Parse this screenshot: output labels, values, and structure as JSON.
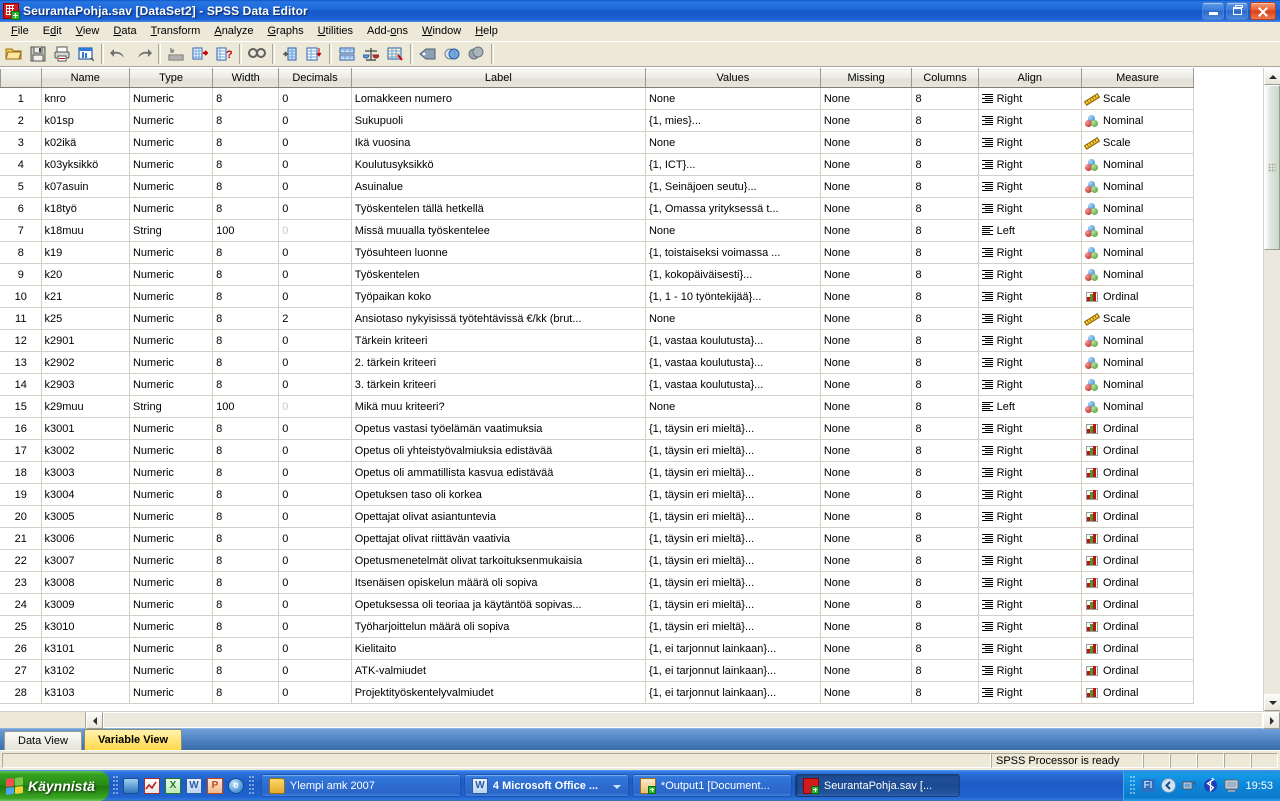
{
  "window": {
    "title": "SeurantaPohja.sav [DataSet2] - SPSS Data Editor",
    "icon": "spss-data-icon",
    "buttons": {
      "minimize": "Minimize",
      "restore": "Restore",
      "close": "Close"
    }
  },
  "menubar": [
    {
      "label": "File",
      "mnemonic": "F"
    },
    {
      "label": "Edit",
      "mnemonic": "E"
    },
    {
      "label": "View",
      "mnemonic": "V"
    },
    {
      "label": "Data",
      "mnemonic": "D"
    },
    {
      "label": "Transform",
      "mnemonic": "T"
    },
    {
      "label": "Analyze",
      "mnemonic": "A"
    },
    {
      "label": "Graphs",
      "mnemonic": "G"
    },
    {
      "label": "Utilities",
      "mnemonic": "U"
    },
    {
      "label": "Add-ons",
      "mnemonic": "o"
    },
    {
      "label": "Window",
      "mnemonic": "W"
    },
    {
      "label": "Help",
      "mnemonic": "H"
    }
  ],
  "toolbar": [
    {
      "name": "open-file",
      "glyph": "📂"
    },
    {
      "name": "save-file",
      "glyph": "💾"
    },
    {
      "name": "print",
      "glyph": "🖨"
    },
    {
      "name": "recall-dialogs",
      "glyph": "▤"
    },
    {
      "name": "undo",
      "glyph": "↶"
    },
    {
      "name": "redo",
      "glyph": "↷"
    },
    {
      "name": "goto-case",
      "glyph": "⬇"
    },
    {
      "name": "goto-variable",
      "glyph": "▦"
    },
    {
      "name": "variables",
      "glyph": "❓"
    },
    {
      "name": "find",
      "glyph": "🔍"
    },
    {
      "name": "insert-case",
      "glyph": "→"
    },
    {
      "name": "insert-variable",
      "glyph": "⬇"
    },
    {
      "name": "split-file",
      "glyph": "☷"
    },
    {
      "name": "weight-cases",
      "glyph": "⚖"
    },
    {
      "name": "select-cases",
      "glyph": "▥"
    },
    {
      "name": "value-labels",
      "glyph": "🏷"
    },
    {
      "name": "use-variable-sets",
      "glyph": "◑"
    },
    {
      "name": "show-all-variables",
      "glyph": "⬤"
    }
  ],
  "grid": {
    "columns": [
      "",
      "Name",
      "Type",
      "Width",
      "Decimals",
      "Label",
      "Values",
      "Missing",
      "Columns",
      "Align",
      "Measure"
    ],
    "rows": [
      {
        "n": "1",
        "name": "knro",
        "type": "Numeric",
        "width": "8",
        "decimals": "0",
        "label": "Lomakkeen numero",
        "values": "None",
        "missing": "None",
        "columns": "8",
        "align": "Right",
        "measure": "Scale"
      },
      {
        "n": "2",
        "name": "k01sp",
        "type": "Numeric",
        "width": "8",
        "decimals": "0",
        "label": "Sukupuoli",
        "values": "{1, mies}...",
        "missing": "None",
        "columns": "8",
        "align": "Right",
        "measure": "Nominal"
      },
      {
        "n": "3",
        "name": "k02ikä",
        "type": "Numeric",
        "width": "8",
        "decimals": "0",
        "label": "Ikä vuosina",
        "values": "None",
        "missing": "None",
        "columns": "8",
        "align": "Right",
        "measure": "Scale"
      },
      {
        "n": "4",
        "name": "k03yksikkö",
        "type": "Numeric",
        "width": "8",
        "decimals": "0",
        "label": "Koulutusyksikkö",
        "values": "{1, ICT}...",
        "missing": "None",
        "columns": "8",
        "align": "Right",
        "measure": "Nominal"
      },
      {
        "n": "5",
        "name": "k07asuin",
        "type": "Numeric",
        "width": "8",
        "decimals": "0",
        "label": "Asuinalue",
        "values": "{1, Seinäjoen seutu}...",
        "missing": "None",
        "columns": "8",
        "align": "Right",
        "measure": "Nominal"
      },
      {
        "n": "6",
        "name": "k18työ",
        "type": "Numeric",
        "width": "8",
        "decimals": "0",
        "label": "Työskentelen tällä hetkellä",
        "values": "{1, Omassa yrityksessä t...",
        "missing": "None",
        "columns": "8",
        "align": "Right",
        "measure": "Nominal"
      },
      {
        "n": "7",
        "name": "k18muu",
        "type": "String",
        "width": "100",
        "decimals": "0",
        "label": "Missä muualla työskentelee",
        "values": "None",
        "missing": "None",
        "columns": "8",
        "align": "Left",
        "measure": "Nominal",
        "decimals_dim": true
      },
      {
        "n": "8",
        "name": "k19",
        "type": "Numeric",
        "width": "8",
        "decimals": "0",
        "label": "Työsuhteen luonne",
        "values": "{1, toistaiseksi voimassa ...",
        "missing": "None",
        "columns": "8",
        "align": "Right",
        "measure": "Nominal"
      },
      {
        "n": "9",
        "name": "k20",
        "type": "Numeric",
        "width": "8",
        "decimals": "0",
        "label": "Työskentelen",
        "values": "{1, kokopäiväisesti}...",
        "missing": "None",
        "columns": "8",
        "align": "Right",
        "measure": "Nominal"
      },
      {
        "n": "10",
        "name": "k21",
        "type": "Numeric",
        "width": "8",
        "decimals": "0",
        "label": "Työpaikan koko",
        "values": "{1, 1 - 10 työntekijää}...",
        "missing": "None",
        "columns": "8",
        "align": "Right",
        "measure": "Ordinal"
      },
      {
        "n": "11",
        "name": "k25",
        "type": "Numeric",
        "width": "8",
        "decimals": "2",
        "label": "Ansiotaso nykyisissä työtehtävissä €/kk (brut...",
        "values": "None",
        "missing": "None",
        "columns": "8",
        "align": "Right",
        "measure": "Scale"
      },
      {
        "n": "12",
        "name": "k2901",
        "type": "Numeric",
        "width": "8",
        "decimals": "0",
        "label": "Tärkein kriteeri",
        "values": "{1, vastaa koulutusta}...",
        "missing": "None",
        "columns": "8",
        "align": "Right",
        "measure": "Nominal"
      },
      {
        "n": "13",
        "name": "k2902",
        "type": "Numeric",
        "width": "8",
        "decimals": "0",
        "label": "2. tärkein kriteeri",
        "values": "{1, vastaa koulutusta}...",
        "missing": "None",
        "columns": "8",
        "align": "Right",
        "measure": "Nominal"
      },
      {
        "n": "14",
        "name": "k2903",
        "type": "Numeric",
        "width": "8",
        "decimals": "0",
        "label": "3. tärkein kriteeri",
        "values": "{1, vastaa koulutusta}...",
        "missing": "None",
        "columns": "8",
        "align": "Right",
        "measure": "Nominal"
      },
      {
        "n": "15",
        "name": "k29muu",
        "type": "String",
        "width": "100",
        "decimals": "0",
        "label": "Mikä muu kriteeri?",
        "values": "None",
        "missing": "None",
        "columns": "8",
        "align": "Left",
        "measure": "Nominal",
        "decimals_dim": true
      },
      {
        "n": "16",
        "name": "k3001",
        "type": "Numeric",
        "width": "8",
        "decimals": "0",
        "label": "Opetus vastasi työelämän vaatimuksia",
        "values": "{1, täysin eri mieltä}...",
        "missing": "None",
        "columns": "8",
        "align": "Right",
        "measure": "Ordinal"
      },
      {
        "n": "17",
        "name": "k3002",
        "type": "Numeric",
        "width": "8",
        "decimals": "0",
        "label": "Opetus oli yhteistyövalmiuksia edistävää",
        "values": "{1, täysin eri mieltä}...",
        "missing": "None",
        "columns": "8",
        "align": "Right",
        "measure": "Ordinal"
      },
      {
        "n": "18",
        "name": "k3003",
        "type": "Numeric",
        "width": "8",
        "decimals": "0",
        "label": "Opetus oli ammatillista kasvua edistävää",
        "values": "{1, täysin eri mieltä}...",
        "missing": "None",
        "columns": "8",
        "align": "Right",
        "measure": "Ordinal"
      },
      {
        "n": "19",
        "name": "k3004",
        "type": "Numeric",
        "width": "8",
        "decimals": "0",
        "label": "Opetuksen taso oli korkea",
        "values": "{1, täysin eri mieltä}...",
        "missing": "None",
        "columns": "8",
        "align": "Right",
        "measure": "Ordinal"
      },
      {
        "n": "20",
        "name": "k3005",
        "type": "Numeric",
        "width": "8",
        "decimals": "0",
        "label": "Opettajat olivat asiantuntevia",
        "values": "{1, täysin eri mieltä}...",
        "missing": "None",
        "columns": "8",
        "align": "Right",
        "measure": "Ordinal"
      },
      {
        "n": "21",
        "name": "k3006",
        "type": "Numeric",
        "width": "8",
        "decimals": "0",
        "label": "Opettajat olivat riittävän vaativia",
        "values": "{1, täysin eri mieltä}...",
        "missing": "None",
        "columns": "8",
        "align": "Right",
        "measure": "Ordinal"
      },
      {
        "n": "22",
        "name": "k3007",
        "type": "Numeric",
        "width": "8",
        "decimals": "0",
        "label": "Opetusmenetelmät olivat tarkoituksenmukaisia",
        "values": "{1, täysin eri mieltä}...",
        "missing": "None",
        "columns": "8",
        "align": "Right",
        "measure": "Ordinal"
      },
      {
        "n": "23",
        "name": "k3008",
        "type": "Numeric",
        "width": "8",
        "decimals": "0",
        "label": "Itsenäisen opiskelun määrä oli sopiva",
        "values": "{1, täysin eri mieltä}...",
        "missing": "None",
        "columns": "8",
        "align": "Right",
        "measure": "Ordinal"
      },
      {
        "n": "24",
        "name": "k3009",
        "type": "Numeric",
        "width": "8",
        "decimals": "0",
        "label": "Opetuksessa oli teoriaa ja käytäntöä sopivas...",
        "values": "{1, täysin eri mieltä}...",
        "missing": "None",
        "columns": "8",
        "align": "Right",
        "measure": "Ordinal"
      },
      {
        "n": "25",
        "name": "k3010",
        "type": "Numeric",
        "width": "8",
        "decimals": "0",
        "label": "Työharjoittelun määrä oli sopiva",
        "values": "{1, täysin eri mieltä}...",
        "missing": "None",
        "columns": "8",
        "align": "Right",
        "measure": "Ordinal"
      },
      {
        "n": "26",
        "name": "k3101",
        "type": "Numeric",
        "width": "8",
        "decimals": "0",
        "label": "Kielitaito",
        "values": "{1, ei tarjonnut lainkaan}...",
        "missing": "None",
        "columns": "8",
        "align": "Right",
        "measure": "Ordinal"
      },
      {
        "n": "27",
        "name": "k3102",
        "type": "Numeric",
        "width": "8",
        "decimals": "0",
        "label": "ATK-valmiudet",
        "values": "{1, ei tarjonnut lainkaan}...",
        "missing": "None",
        "columns": "8",
        "align": "Right",
        "measure": "Ordinal"
      },
      {
        "n": "28",
        "name": "k3103",
        "type": "Numeric",
        "width": "8",
        "decimals": "0",
        "label": "Projektityöskentelyvalmiudet",
        "values": "{1, ei tarjonnut lainkaan}...",
        "missing": "None",
        "columns": "8",
        "align": "Right",
        "measure": "Ordinal"
      }
    ]
  },
  "tabs": [
    {
      "label": "Data View",
      "active": false
    },
    {
      "label": "Variable View",
      "active": true
    }
  ],
  "statusbar": {
    "message": "SPSS  Processor is ready"
  },
  "taskbar": {
    "start_label": "Käynnistä",
    "quicklaunch": [
      {
        "name": "show-desktop-icon",
        "glyph": "▣"
      },
      {
        "name": "media-player-icon",
        "glyph": "▶"
      },
      {
        "name": "excel-icon",
        "glyph": "X"
      },
      {
        "name": "word-icon",
        "glyph": "W"
      },
      {
        "name": "powerpoint-icon",
        "glyph": "P"
      },
      {
        "name": "internet-explorer-icon",
        "glyph": "e"
      }
    ],
    "tasks": [
      {
        "label": "Ylempi amk 2007",
        "icon": "folder-icon",
        "active": false,
        "caret": false
      },
      {
        "label": "4 Microsoft Office ...",
        "icon": "word-icon",
        "active": false,
        "caret": true
      },
      {
        "label": "*Output1 [Document...",
        "icon": "spss-output-icon",
        "active": false,
        "caret": false
      },
      {
        "label": "SeurantaPohja.sav [...",
        "icon": "spss-data-icon",
        "active": true,
        "caret": false
      }
    ],
    "tray": {
      "language": "FI",
      "icons": [
        {
          "name": "show-hidden-icons",
          "glyph": "◀"
        },
        {
          "name": "network-icon",
          "glyph": "🖥"
        },
        {
          "name": "bluetooth-icon",
          "glyph": "ᛗ"
        },
        {
          "name": "display-icon",
          "glyph": "🖵"
        }
      ],
      "clock": "19:53"
    }
  },
  "colors": {
    "titlebar_blue": "#1f6bdd",
    "window_face": "#ece9d8",
    "active_tab_yellow": "#ffd84a",
    "taskbar_blue": "#1d5bc4",
    "start_green": "#2a8c16"
  }
}
